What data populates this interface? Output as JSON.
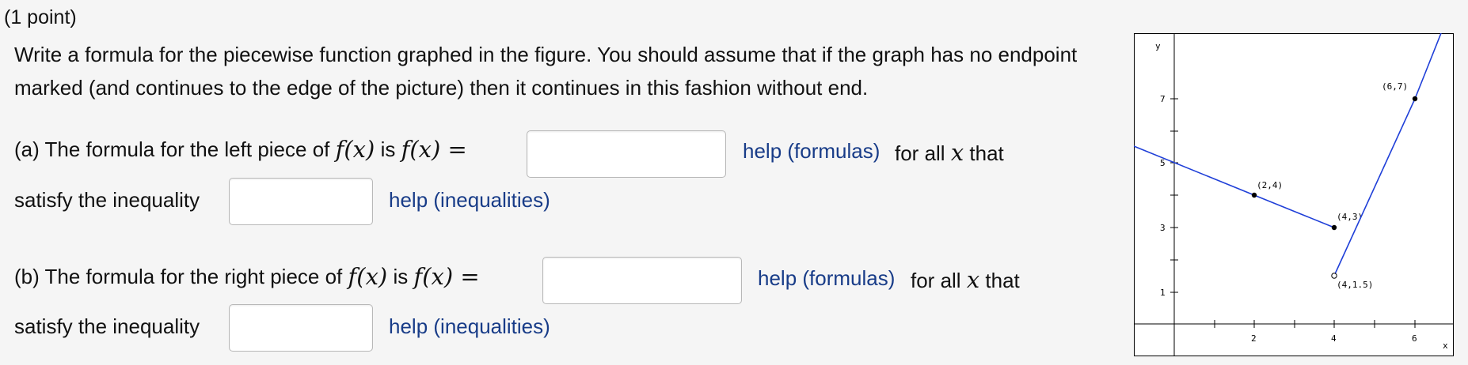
{
  "points_label": "(1 point)",
  "prompt": "Write a formula for the piecewise function graphed in the figure. You should assume that if the graph has no endpoint marked (and continues to the edge of the picture) then it continues in this fashion without end.",
  "part_a": {
    "prefix": "(a) The formula for the left piece of",
    "fx": "f(x)",
    "is": "is",
    "fx_eq": "f(x) =",
    "help_formulas": "help (formulas)",
    "for_all": "for all",
    "x": "x",
    "that": "that",
    "satisfy": "satisfy the inequality",
    "help_inequalities": "help (inequalities)",
    "formula_value": "",
    "inequality_value": ""
  },
  "part_b": {
    "prefix": "(b) The formula for the right piece of",
    "fx": "f(x)",
    "is": "is",
    "fx_eq": "f(x) =",
    "help_formulas": "help (formulas)",
    "for_all": "for all",
    "x": "x",
    "that": "that",
    "satisfy": "satisfy the inequality",
    "help_inequalities": "help (inequalities)",
    "formula_value": "",
    "inequality_value": ""
  },
  "graph": {
    "y_axis_label": "y",
    "x_axis_label": "x",
    "y_ticks": [
      "7",
      "5",
      "3",
      "1"
    ],
    "x_ticks": [
      "2",
      "4",
      "6"
    ],
    "line_color": "#1f3fd8",
    "labels": {
      "p1": "(2,4)",
      "p2": "(4,3)",
      "p3": "(4,1.5)",
      "p4": "(6,7)"
    }
  }
}
